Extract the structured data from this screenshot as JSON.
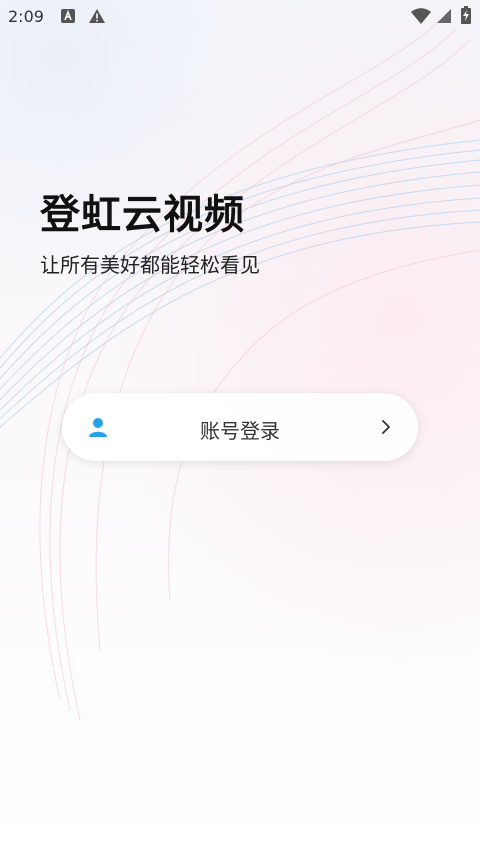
{
  "status_bar": {
    "time": "2:09",
    "icons": [
      "keyboard-a-icon",
      "warning-icon",
      "wifi-icon",
      "signal-icon",
      "battery-charging-icon"
    ]
  },
  "app": {
    "title": "登虹云视频",
    "slogan": "让所有美好都能轻松看见"
  },
  "login": {
    "label": "账号登录",
    "icon": "user-icon",
    "accent": "#29a3e8"
  }
}
